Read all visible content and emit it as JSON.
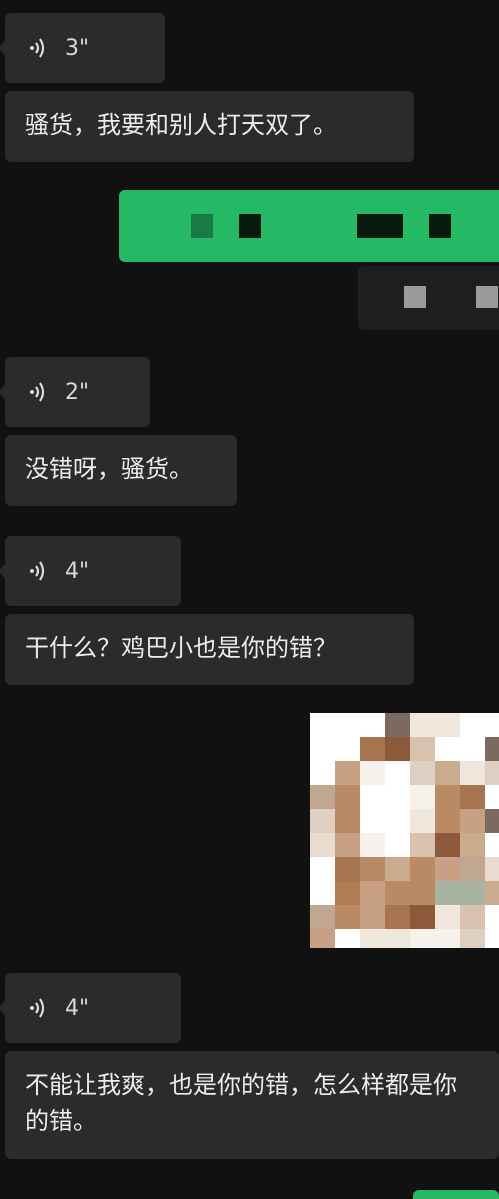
{
  "messages": [
    {
      "type": "voice",
      "duration": "3\""
    },
    {
      "type": "text",
      "text": "骚货，我要和别人打天双了。"
    },
    {
      "type": "image_redacted",
      "side": "right",
      "colors": {
        "bubble": "#25b865"
      }
    },
    {
      "type": "voice",
      "duration": "2\""
    },
    {
      "type": "text",
      "text": "没错呀，骚货。"
    },
    {
      "type": "voice",
      "duration": "4\""
    },
    {
      "type": "text",
      "text": "干什么？鸡巴小也是你的错？"
    },
    {
      "type": "image",
      "side": "right",
      "description": "pixelated photo"
    },
    {
      "type": "voice",
      "duration": "4\""
    },
    {
      "type": "text",
      "text": "不能让我爽，也是你的错，怎么样都是你的错。"
    }
  ],
  "icons": {
    "voice": "voice-wave-icon"
  },
  "colors": {
    "background": "#111111",
    "incoming_bubble": "#2b2b2b",
    "outgoing_bubble": "#25b865"
  }
}
